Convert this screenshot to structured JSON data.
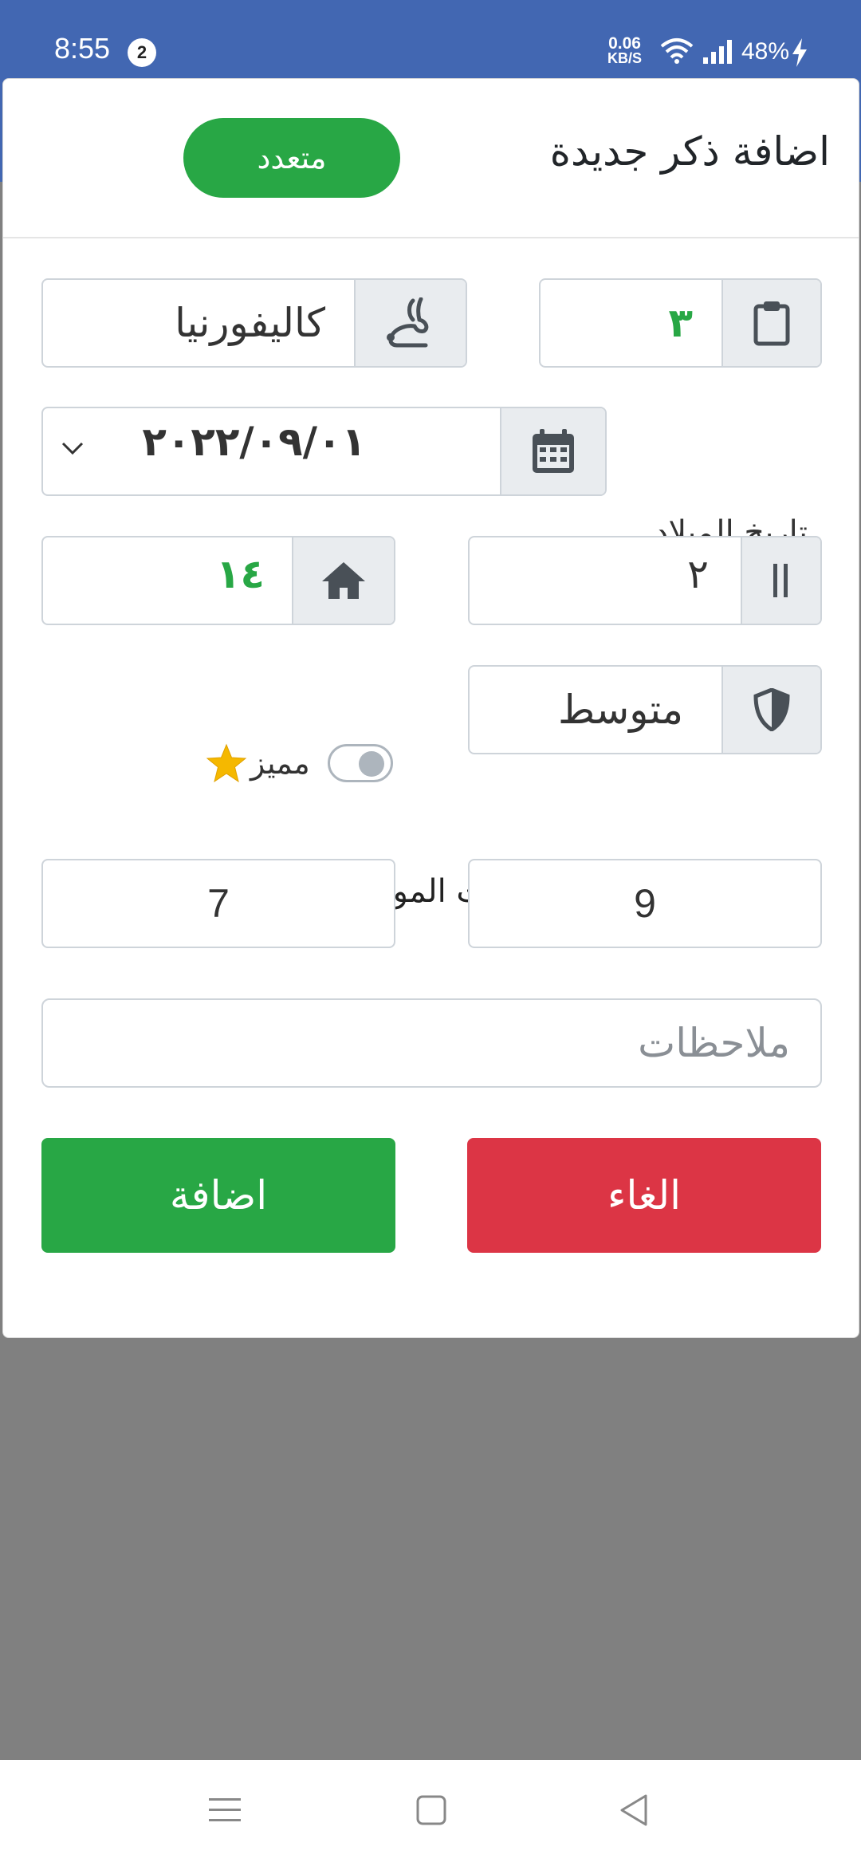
{
  "status_bar": {
    "time": "8:55",
    "notification_count": "2",
    "net_speed_value": "0.06",
    "net_speed_unit": "KB/S",
    "battery": "48%"
  },
  "modal": {
    "title": "اضافة ذكر جديدة",
    "multi_button": "متعدد",
    "fields": {
      "number": "٣",
      "breed": "كاليفورنيا",
      "birth_label": "تاريخ الميلاد",
      "birth_date": "٢٠٢٢/٠٩/٠١",
      "cage_number": "٢",
      "house_number": "١٤",
      "level": "متوسط",
      "featured_label": "مميز",
      "vaccination_hint": "التلقيحات وعدد.التلقيحات الموجبة السابقة (اختياري)",
      "vaccinations": "9",
      "positive_vaccinations": "7",
      "notes_placeholder": "ملاحظات"
    },
    "buttons": {
      "cancel": "الغاء",
      "add": "اضافة"
    }
  },
  "colors": {
    "primary_blue": "#4267b2",
    "success_green": "#28a745",
    "danger_red": "#dc3545",
    "addon_gray": "#e9ecef"
  },
  "icons": [
    "clipboard-icon",
    "rabbit-icon",
    "calendar-icon",
    "cage-icon",
    "home-icon",
    "shield-icon",
    "star-icon",
    "chevron-down-icon",
    "menu-icon",
    "home-square-icon",
    "back-icon"
  ]
}
